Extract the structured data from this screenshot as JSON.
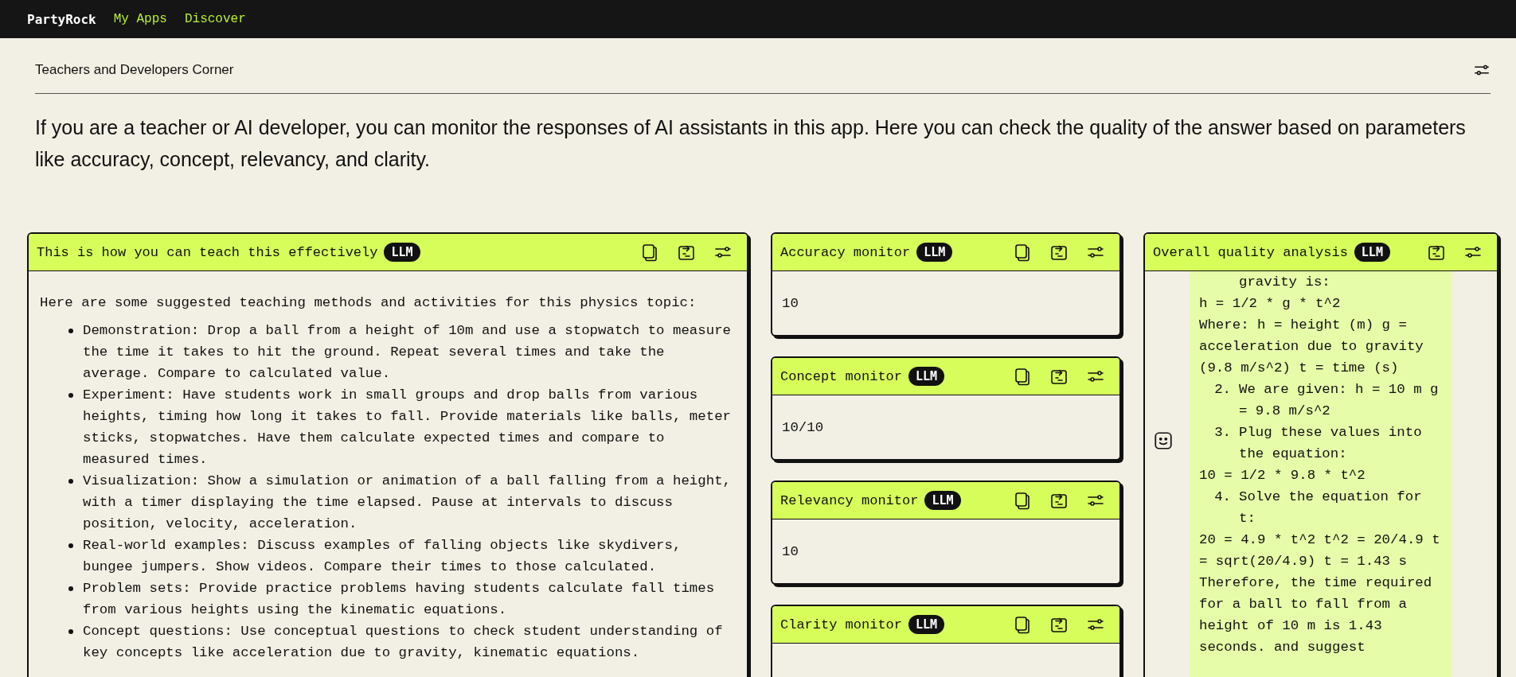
{
  "nav": {
    "brand": "PartyRock",
    "links": [
      {
        "label": "My Apps"
      },
      {
        "label": "Discover"
      }
    ]
  },
  "section": {
    "title": "Teachers and Developers Corner",
    "description": "If you are a teacher or AI developer, you can monitor the responses of AI assistants in this app. Here you can check the quality of the answer based on parameters like accuracy, concept, relevancy, and clarity."
  },
  "teaching_card": {
    "title": "This is how you can teach this effectively",
    "badge": "LLM",
    "intro": "Here are some suggested teaching methods and activities for this physics topic:",
    "items": [
      "Demonstration: Drop a ball from a height of 10m and use a stopwatch to measure the time it takes to hit the ground. Repeat several times and take the average. Compare to calculated value.",
      "Experiment: Have students work in small groups and drop balls from various heights, timing how long it takes to fall. Provide materials like balls, meter sticks, stopwatches. Have them calculate expected times and compare to measured times.",
      "Visualization: Show a simulation or animation of a ball falling from a height, with a timer displaying the time elapsed. Pause at intervals to discuss position, velocity, acceleration.",
      "Real-world examples: Discuss examples of falling objects like skydivers, bungee jumpers. Show videos. Compare their times to those calculated.",
      "Problem sets: Provide practice problems having students calculate fall times from various heights using the kinematic equations.",
      "Concept questions: Use conceptual questions to check student understanding of key concepts like acceleration due to gravity, kinematic equations."
    ]
  },
  "monitors": [
    {
      "title": "Accuracy monitor",
      "badge": "LLM",
      "value": "10"
    },
    {
      "title": "Concept monitor",
      "badge": "LLM",
      "value": "10/10"
    },
    {
      "title": "Relevancy monitor",
      "badge": "LLM",
      "value": "10"
    },
    {
      "title": "Clarity monitor",
      "badge": "LLM"
    }
  ],
  "analysis_card": {
    "title": "Overall quality analysis",
    "badge": "LLM",
    "lines": [
      {
        "kind": "continuation",
        "text": "gravity is:"
      },
      {
        "kind": "text",
        "text": "h = 1/2 * g * t^2"
      },
      {
        "kind": "text",
        "text": "Where: h = height (m) g = acceleration due to gravity (9.8 m/s^2) t = time (s)"
      },
      {
        "kind": "numbered",
        "number": "2.",
        "text": "We are given: h = 10 m g = 9.8 m/s^2"
      },
      {
        "kind": "numbered",
        "number": "3.",
        "text": "Plug these values into the equation:"
      },
      {
        "kind": "text",
        "text": "10 = 1/2 * 9.8 * t^2"
      },
      {
        "kind": "numbered",
        "number": "4.",
        "text": "Solve the equation for t:"
      },
      {
        "kind": "text",
        "text": "20 = 4.9 * t^2 t^2 = 20/4.9 t = sqrt(20/4.9) t = 1.43 s"
      },
      {
        "kind": "text",
        "text": "Therefore, the time required for a ball to fall from a height of 10 m is 1.43 seconds. and suggest"
      }
    ]
  }
}
